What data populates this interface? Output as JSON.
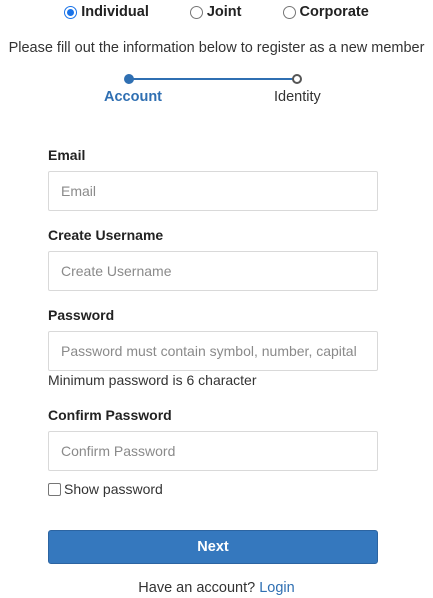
{
  "account_types": [
    {
      "label": "Individual",
      "selected": true
    },
    {
      "label": "Joint",
      "selected": false
    },
    {
      "label": "Corporate",
      "selected": false
    }
  ],
  "intro_text": "Please fill out the information below to register as a new member",
  "stepper": {
    "steps": [
      {
        "label": "Account",
        "state": "active"
      },
      {
        "label": "Identity",
        "state": "pending"
      }
    ]
  },
  "form": {
    "email": {
      "label": "Email",
      "value": "",
      "placeholder": "Email"
    },
    "username": {
      "label": "Create Username",
      "value": "",
      "placeholder": "Create Username"
    },
    "password": {
      "label": "Password",
      "value": "",
      "placeholder": "Password must contain symbol, number, capital"
    },
    "password_hint": "Minimum password is 6 character",
    "confirm_password": {
      "label": "Confirm Password",
      "value": "",
      "placeholder": "Confirm Password"
    },
    "show_password": {
      "label": "Show password",
      "checked": false
    },
    "next_label": "Next"
  },
  "footer": {
    "prompt": "Have an account?",
    "login_label": "Login"
  },
  "colors": {
    "accent": "#2f6fb2",
    "button": "#3578be",
    "radio_selected": "#1a73e8",
    "input_border": "#d9d9d9"
  }
}
